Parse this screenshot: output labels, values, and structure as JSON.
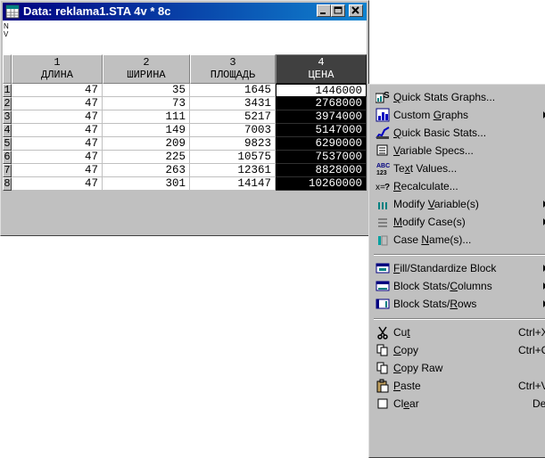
{
  "window": {
    "title": "Data: reklama1.STA 4v * 8c",
    "info_labels": [
      "N",
      "V"
    ]
  },
  "columns": [
    {
      "num": "1",
      "name": "ДЛИНА"
    },
    {
      "num": "2",
      "name": "ШИРИНА"
    },
    {
      "num": "3",
      "name": "ПЛОЩАДЬ"
    },
    {
      "num": "4",
      "name": "ЦЕНА"
    }
  ],
  "rows": [
    {
      "n": "1",
      "cells": [
        "47",
        "35",
        "1645",
        "1446000"
      ]
    },
    {
      "n": "2",
      "cells": [
        "47",
        "73",
        "3431",
        "2768000"
      ]
    },
    {
      "n": "3",
      "cells": [
        "47",
        "111",
        "5217",
        "3974000"
      ]
    },
    {
      "n": "4",
      "cells": [
        "47",
        "149",
        "7003",
        "5147000"
      ]
    },
    {
      "n": "5",
      "cells": [
        "47",
        "209",
        "9823",
        "6290000"
      ]
    },
    {
      "n": "6",
      "cells": [
        "47",
        "225",
        "10575",
        "7537000"
      ]
    },
    {
      "n": "7",
      "cells": [
        "47",
        "263",
        "12361",
        "8828000"
      ]
    },
    {
      "n": "8",
      "cells": [
        "47",
        "301",
        "14147",
        "10260000"
      ]
    }
  ],
  "menu": {
    "items": [
      {
        "u": "Q",
        "rest": "uick Stats Graphs...",
        "icon": "quick-stats-graphs-icon",
        "submenu": false
      },
      {
        "pre": "Custom ",
        "u": "G",
        "rest": "raphs",
        "icon": "custom-graphs-icon",
        "submenu": true
      },
      {
        "u": "Q",
        "rest": "uick Basic Stats...",
        "icon": "quick-basic-stats-icon",
        "submenu": false
      },
      {
        "u": "V",
        "rest": "ariable Specs...",
        "icon": "variable-specs-icon",
        "submenu": false
      },
      {
        "pre": "Te",
        "u": "x",
        "rest": "t Values...",
        "icon": "text-values-icon",
        "submenu": false
      },
      {
        "u": "R",
        "rest": "ecalculate...",
        "icon": "recalculate-icon",
        "submenu": false
      },
      {
        "pre": "Modify ",
        "u": "V",
        "rest": "ariable(s)",
        "icon": "modify-variables-icon",
        "submenu": true
      },
      {
        "u": "M",
        "rest": "odify Case(s)",
        "icon": "modify-cases-icon",
        "submenu": true
      },
      {
        "pre": "Case ",
        "u": "N",
        "rest": "ame(s)...",
        "icon": "case-names-icon",
        "submenu": false
      },
      {
        "u": "F",
        "rest": "ill/Standardize Block",
        "icon": "fill-standardize-icon",
        "submenu": true
      },
      {
        "pre": "Block Stats/",
        "u": "C",
        "rest": "olumns",
        "icon": "block-stats-columns-icon",
        "submenu": true
      },
      {
        "pre": "Block Stats/",
        "u": "R",
        "rest": "ows",
        "icon": "block-stats-rows-icon",
        "submenu": true
      },
      {
        "pre": "Cu",
        "u": "t",
        "rest": "",
        "shortcut": "Ctrl+X",
        "icon": "cut-icon",
        "submenu": false
      },
      {
        "u": "C",
        "rest": "opy",
        "shortcut": "Ctrl+C",
        "icon": "copy-icon",
        "submenu": false
      },
      {
        "u": "C",
        "rest": "opy Raw",
        "icon": "copy-raw-icon",
        "submenu": false
      },
      {
        "u": "P",
        "rest": "aste",
        "shortcut": "Ctrl+V",
        "icon": "paste-icon",
        "submenu": false
      },
      {
        "pre": "Cl",
        "u": "e",
        "rest": "ar",
        "shortcut": "Del",
        "icon": "clear-icon",
        "submenu": false
      }
    ]
  }
}
